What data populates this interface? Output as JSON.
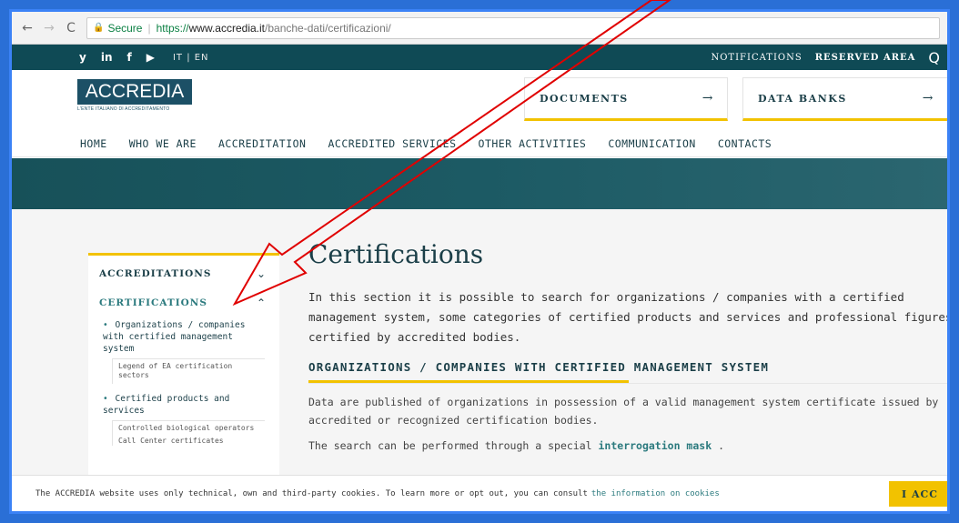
{
  "browser": {
    "back_icon": "←",
    "forward_icon": "→",
    "reload_icon": "C",
    "secure_label": "Secure",
    "url_scheme": "https://",
    "url_host": "www.accredia.it",
    "url_path": "/banche-dati/certificazioni/"
  },
  "topbar": {
    "social": [
      "y",
      "in",
      "f",
      "▶"
    ],
    "lang": "IT | EN",
    "notifications": "NOTIFICATIONS",
    "reserved_area": "RESERVED AREA",
    "search_glyph": "Q"
  },
  "header": {
    "logo_text": "ACCREDIA",
    "logo_sub": "L'ENTE ITALIANO DI ACCREDITAMENTO",
    "documents": "DOCUMENTS",
    "data_banks": "DATA BANKS",
    "arrow": "→"
  },
  "nav": [
    "HOME",
    "WHO WE ARE",
    "ACCREDITATION",
    "ACCREDITED SERVICES",
    "OTHER ACTIVITIES",
    "COMMUNICATION",
    "CONTACTS"
  ],
  "sidebar": {
    "accreditations": "ACCREDITATIONS",
    "certifications": "CERTIFICATIONS",
    "chev_down": "⌄",
    "chev_up": "⌃",
    "item1": "Organizations / companies with certified management system",
    "sub1": "Legend of EA certification sectors",
    "item2": "Certified products and services",
    "sub2": "Controlled biological operators",
    "sub3": "Call Center certificates",
    "bullet": "•"
  },
  "main": {
    "title": "Certifications",
    "intro": "In this section it is possible to search for organizations / companies with a certified management system, some categories of certified products and services and professional figures certified by accredited bodies.",
    "section_title": "ORGANIZATIONS / COMPANIES WITH CERTIFIED MANAGEMENT SYSTEM",
    "body1": "Data are published of organizations in possession of a valid management system certificate issued by accredited or recognized certification bodies.",
    "body2_prefix": "The search can be performed through a special",
    "body2_link": "interrogation mask",
    "body2_suffix": "."
  },
  "cookie": {
    "text": "The ACCREDIA website uses only technical, own and third-party cookies. To learn more or opt out, you can consult",
    "link": "the information on cookies",
    "button": "I ACC"
  },
  "colors": {
    "dark_teal": "#0f4a55",
    "accent_yellow": "#f2c200",
    "annotation_red": "#e00000"
  }
}
